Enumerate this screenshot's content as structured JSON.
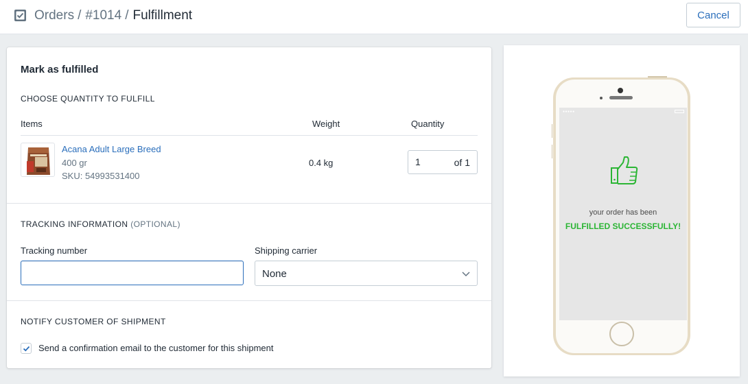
{
  "breadcrumb": {
    "orders": "Orders",
    "order_id": "#1014",
    "current": "Fulfillment",
    "separator": "/"
  },
  "header": {
    "cancel_label": "Cancel",
    "icon": "checkbox-icon"
  },
  "fulfillment": {
    "title": "Mark as fulfilled",
    "choose_quantity_heading": "CHOOSE QUANTITY TO FULFILL",
    "columns": {
      "items": "Items",
      "weight": "Weight",
      "quantity": "Quantity"
    },
    "item": {
      "name": "Acana Adult Large Breed",
      "variant": "400 gr",
      "sku": "SKU: 54993531400",
      "weight": "0.4 kg",
      "quantity_value": "1",
      "quantity_of": "of 1"
    },
    "tracking": {
      "heading": "TRACKING INFORMATION",
      "heading_optional": "(OPTIONAL)",
      "tracking_label": "Tracking number",
      "tracking_value": "",
      "carrier_label": "Shipping carrier",
      "carrier_value": "None"
    },
    "notify": {
      "heading": "NOTIFY CUSTOMER OF SHIPMENT",
      "checkbox_label": "Send a confirmation email to the customer for this shipment",
      "checked": true
    }
  },
  "preview": {
    "message_line1": "your order has been",
    "message_line2": "FULFILLED SUCCESSFULLY!",
    "icon": "thumbs-up-icon"
  },
  "colors": {
    "accent": "#2a6ebb",
    "success": "#2bb534",
    "background": "#ebeef0"
  }
}
